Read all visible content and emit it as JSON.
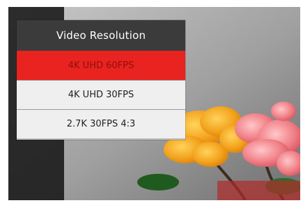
{
  "menu": {
    "title": "Video Resolution",
    "items": [
      {
        "label": "4K UHD 60FPS",
        "selected": true
      },
      {
        "label": "4K UHD 30FPS",
        "selected": false
      },
      {
        "label": "2.7K 30FPS 4:3",
        "selected": false
      }
    ]
  },
  "colors": {
    "title_bar": "#3b3b3b",
    "selected_item": "#e9231f",
    "menu_background": "#efefef"
  }
}
